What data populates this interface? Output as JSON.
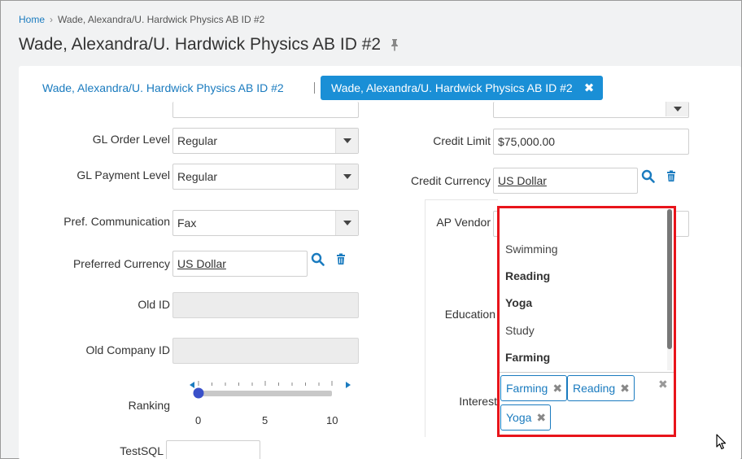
{
  "breadcrumb": {
    "home": "Home",
    "current": "Wade, Alexandra/U. Hardwick Physics AB ID #2"
  },
  "page": {
    "title": "Wade, Alexandra/U. Hardwick Physics AB ID #2"
  },
  "tabs": {
    "first": "Wade, Alexandra/U. Hardwick Physics AB ID #2",
    "active": "Wade, Alexandra/U. Hardwick Physics AB ID #2"
  },
  "left_form": {
    "gl_order_level": {
      "label": "GL Order Level",
      "value": "Regular"
    },
    "gl_payment_level": {
      "label": "GL Payment Level",
      "value": "Regular"
    },
    "pref_communication": {
      "label": "Pref. Communication",
      "value": "Fax"
    },
    "preferred_currency": {
      "label": "Preferred Currency",
      "value": "US Dollar"
    },
    "old_id": {
      "label": "Old ID",
      "value": ""
    },
    "old_company_id": {
      "label": "Old Company ID",
      "value": ""
    },
    "ranking": {
      "label": "Ranking",
      "min": "0",
      "mid": "5",
      "max": "10",
      "value": 0
    },
    "test_sql": {
      "label": "TestSQL",
      "value": ""
    }
  },
  "right_form": {
    "credit_limit": {
      "label": "Credit Limit",
      "value": "$75,000.00"
    },
    "credit_currency": {
      "label": "Credit Currency",
      "value": "US Dollar"
    },
    "ap_vendor": {
      "label": "AP Vendor"
    },
    "education": {
      "label": "Education"
    },
    "interest": {
      "label": "Interest"
    }
  },
  "dropdown": {
    "options": [
      {
        "label": "Swimming",
        "selected": false
      },
      {
        "label": "Reading",
        "selected": true
      },
      {
        "label": "Yoga",
        "selected": true
      },
      {
        "label": "Study",
        "selected": false
      },
      {
        "label": "Farming",
        "selected": true
      }
    ]
  },
  "tags": [
    "Farming",
    "Reading",
    "Yoga"
  ],
  "colors": {
    "accent": "#1a8fd6",
    "link": "#1a7bbf",
    "highlight": "#e8141b"
  }
}
